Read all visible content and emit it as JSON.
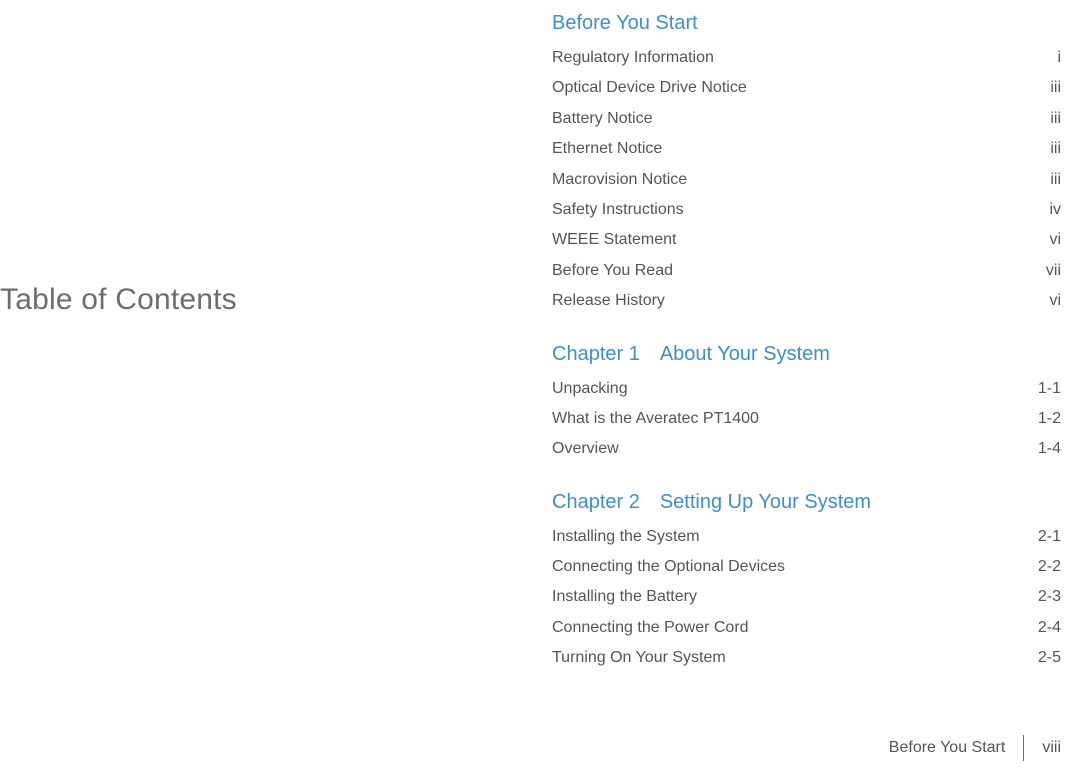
{
  "main_title": "Table of Contents",
  "sections": [
    {
      "heading": "Before You Start",
      "entries": [
        {
          "label": "Regulatory Information",
          "page": "i"
        },
        {
          "label": "Optical Device Drive Notice",
          "page": "iii"
        },
        {
          "label": "Battery Notice",
          "page": "iii"
        },
        {
          "label": "Ethernet Notice",
          "page": "iii"
        },
        {
          "label": "Macrovision Notice",
          "page": "iii"
        },
        {
          "label": "Safety Instructions",
          "page": "iv"
        },
        {
          "label": "WEEE Statement",
          "page": "vi"
        },
        {
          "label": "Before You Read",
          "page": "vii"
        },
        {
          "label": "Release History",
          "page": "vi"
        }
      ]
    },
    {
      "heading": "Chapter 1 About Your System",
      "entries": [
        {
          "label": "Unpacking",
          "page": "1-1"
        },
        {
          "label": "What is the Averatec PT1400",
          "page": "1-2"
        },
        {
          "label": "Overview",
          "page": "1-4"
        }
      ]
    },
    {
      "heading": "Chapter 2 Setting Up Your System",
      "entries": [
        {
          "label": "Installing the System",
          "page": "2-1"
        },
        {
          "label": "Connecting the Optional Devices",
          "page": "2-2"
        },
        {
          "label": "Installing the Battery",
          "page": "2-3"
        },
        {
          "label": "Connecting the Power Cord",
          "page": "2-4"
        },
        {
          "label": "Turning On Your System",
          "page": "2-5"
        }
      ]
    }
  ],
  "footer": {
    "section_name": "Before You Start",
    "page_number": "viii"
  }
}
